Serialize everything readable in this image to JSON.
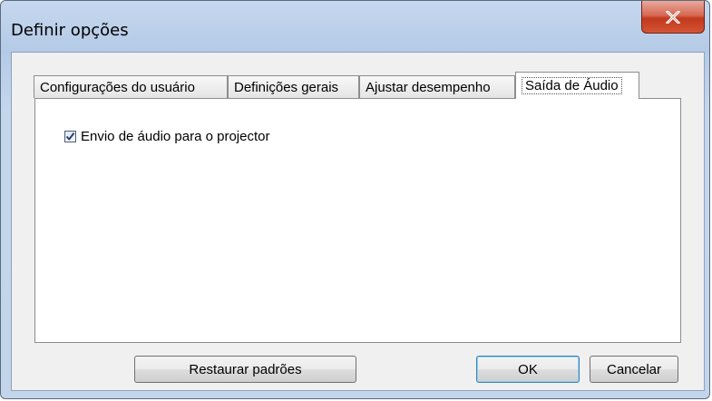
{
  "window": {
    "title": "Definir opções",
    "close_icon": "close-icon"
  },
  "tabs": [
    {
      "label": "Configurações do usuário",
      "active": false
    },
    {
      "label": "Definições gerais",
      "active": false
    },
    {
      "label": "Ajustar desempenho",
      "active": false
    },
    {
      "label": "Saída de Áudio",
      "active": true
    }
  ],
  "panel": {
    "audio_checkbox": {
      "label": "Envio de áudio para o projector",
      "checked": true
    }
  },
  "buttons": {
    "restore_label": "Restaurar padrões",
    "ok_label": "OK",
    "cancel_label": "Cancelar"
  },
  "colors": {
    "close_button": "#c7432a",
    "title_bar": "#b9cde6",
    "default_button_border": "#3c7fb1"
  }
}
